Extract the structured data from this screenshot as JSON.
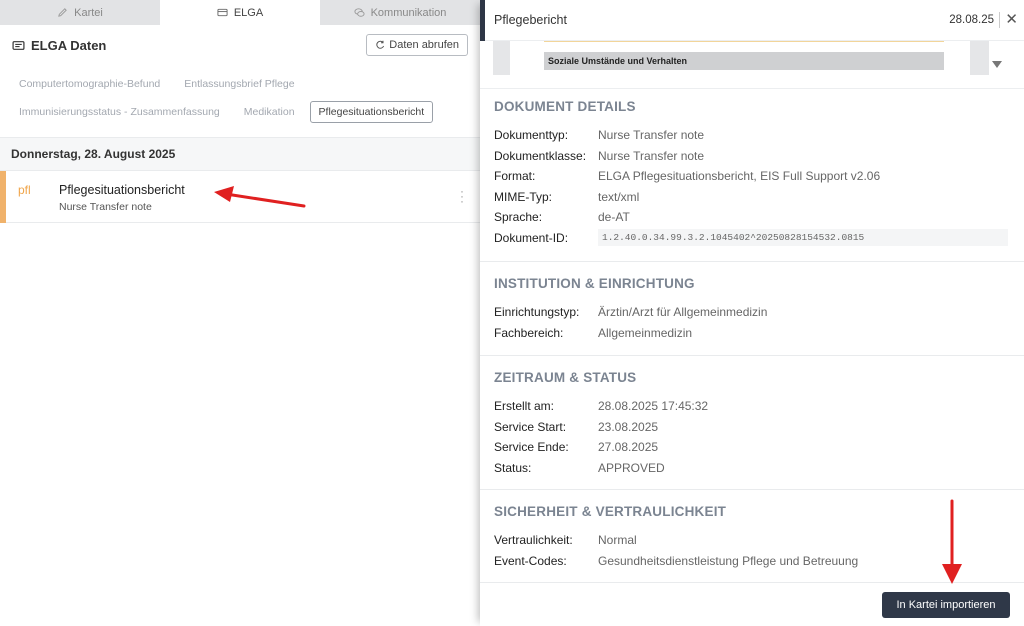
{
  "tabs": [
    {
      "label": "Kartei",
      "icon": "pencil-icon"
    },
    {
      "label": "ELGA",
      "icon": "card-icon"
    },
    {
      "label": "Kommunikation",
      "icon": "chat-icon"
    }
  ],
  "elga": {
    "title": "ELGA Daten",
    "fetch_label": "Daten abrufen",
    "categories_row1": [
      "Computertomographie-Befund",
      "Entlassungsbrief Pflege"
    ],
    "categories_row2": [
      "Immunisierungsstatus - Zusammenfassung",
      "Medikation",
      "Pflegesituationsbericht"
    ],
    "active_category": "Pflegesituationsbericht",
    "date_group": "Donnerstag, 28. August 2025",
    "document": {
      "abbr": "pfl",
      "title": "Pflegesituationsbericht",
      "subtitle": "Nurse Transfer note"
    }
  },
  "detail": {
    "title": "Pflegebericht",
    "date": "28.08.25",
    "close": "✕",
    "preview_section": "Soziale Umstände und Verhalten",
    "sections": [
      {
        "heading": "DOKUMENT DETAILS",
        "rows": [
          {
            "k": "Dokumenttyp:",
            "v": "Nurse Transfer note"
          },
          {
            "k": "Dokumentklasse:",
            "v": "Nurse Transfer note"
          },
          {
            "k": "Format:",
            "v": "ELGA Pflegesituationsbericht, EIS Full Support v2.06"
          },
          {
            "k": "MIME-Typ:",
            "v": "text/xml"
          },
          {
            "k": "Sprache:",
            "v": "de-AT"
          },
          {
            "k": "Dokument-ID:",
            "v": "1.2.40.0.34.99.3.2.1045402^20250828154532.0815"
          }
        ]
      },
      {
        "heading": "INSTITUTION & EINRICHTUNG",
        "rows": [
          {
            "k": "Einrichtungstyp:",
            "v": "Ärztin/Arzt für Allgemeinmedizin"
          },
          {
            "k": "Fachbereich:",
            "v": "Allgemeinmedizin"
          }
        ]
      },
      {
        "heading": "ZEITRAUM & STATUS",
        "rows": [
          {
            "k": "Erstellt am:",
            "v": "28.08.2025 17:45:32"
          },
          {
            "k": "Service Start:",
            "v": "23.08.2025"
          },
          {
            "k": "Service Ende:",
            "v": "27.08.2025"
          },
          {
            "k": "Status:",
            "v": "APPROVED"
          }
        ]
      },
      {
        "heading": "SICHERHEIT & VERTRAULICHKEIT",
        "rows": [
          {
            "k": "Vertraulichkeit:",
            "v": "Normal"
          },
          {
            "k": "Event-Codes:",
            "v": "Gesundheitsdienstleistung Pflege und Betreuung"
          }
        ]
      }
    ],
    "import_label": "In Kartei importieren"
  },
  "colors": {
    "accent_orange": "#f0b26b",
    "dark_button": "#2f3848",
    "annotation_red": "#e02020"
  }
}
